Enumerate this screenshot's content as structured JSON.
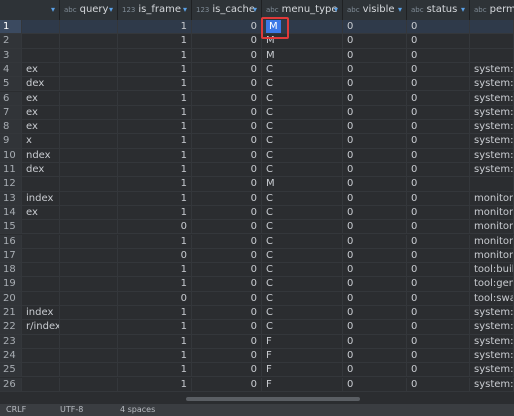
{
  "columns": [
    {
      "label": "",
      "type": ""
    },
    {
      "label": "query",
      "type": "abc"
    },
    {
      "label": "is_frame",
      "type": "123"
    },
    {
      "label": "is_cache",
      "type": "123"
    },
    {
      "label": "menu_type",
      "type": "abc"
    },
    {
      "label": "visible",
      "type": "abc"
    },
    {
      "label": "status",
      "type": "abc"
    },
    {
      "label": "perms",
      "type": "abc"
    }
  ],
  "rows": [
    {
      "num": "1",
      "path": "",
      "query": "",
      "is_frame": "1",
      "is_cache": "0",
      "menu_type": "M",
      "visible": "0",
      "status": "0",
      "perms": ""
    },
    {
      "num": "2",
      "path": "",
      "query": "",
      "is_frame": "1",
      "is_cache": "0",
      "menu_type": "M",
      "visible": "0",
      "status": "0",
      "perms": ""
    },
    {
      "num": "3",
      "path": "",
      "query": "",
      "is_frame": "1",
      "is_cache": "0",
      "menu_type": "M",
      "visible": "0",
      "status": "0",
      "perms": ""
    },
    {
      "num": "4",
      "path": "ex",
      "query": "",
      "is_frame": "1",
      "is_cache": "0",
      "menu_type": "C",
      "visible": "0",
      "status": "0",
      "perms": "system:us"
    },
    {
      "num": "5",
      "path": "dex",
      "query": "",
      "is_frame": "1",
      "is_cache": "0",
      "menu_type": "C",
      "visible": "0",
      "status": "0",
      "perms": "system:m"
    },
    {
      "num": "6",
      "path": "ex",
      "query": "",
      "is_frame": "1",
      "is_cache": "0",
      "menu_type": "C",
      "visible": "0",
      "status": "0",
      "perms": "system:ro"
    },
    {
      "num": "7",
      "path": "ex",
      "query": "",
      "is_frame": "1",
      "is_cache": "0",
      "menu_type": "C",
      "visible": "0",
      "status": "0",
      "perms": "system:po"
    },
    {
      "num": "8",
      "path": "ex",
      "query": "",
      "is_frame": "1",
      "is_cache": "0",
      "menu_type": "C",
      "visible": "0",
      "status": "0",
      "perms": "system:de"
    },
    {
      "num": "9",
      "path": "x",
      "query": "",
      "is_frame": "1",
      "is_cache": "0",
      "menu_type": "C",
      "visible": "0",
      "status": "0",
      "perms": "system:di"
    },
    {
      "num": "10",
      "path": "ndex",
      "query": "",
      "is_frame": "1",
      "is_cache": "0",
      "menu_type": "C",
      "visible": "0",
      "status": "0",
      "perms": "system:co"
    },
    {
      "num": "11",
      "path": "dex",
      "query": "",
      "is_frame": "1",
      "is_cache": "0",
      "menu_type": "C",
      "visible": "0",
      "status": "0",
      "perms": "system:no"
    },
    {
      "num": "12",
      "path": "",
      "query": "",
      "is_frame": "1",
      "is_cache": "0",
      "menu_type": "M",
      "visible": "0",
      "status": "0",
      "perms": ""
    },
    {
      "num": "13",
      "path": "index",
      "query": "",
      "is_frame": "1",
      "is_cache": "0",
      "menu_type": "C",
      "visible": "0",
      "status": "0",
      "perms": "monitor:o"
    },
    {
      "num": "14",
      "path": "ex",
      "query": "",
      "is_frame": "1",
      "is_cache": "0",
      "menu_type": "C",
      "visible": "0",
      "status": "0",
      "perms": "monitor:jo"
    },
    {
      "num": "15",
      "path": "",
      "query": "",
      "is_frame": "0",
      "is_cache": "0",
      "menu_type": "C",
      "visible": "0",
      "status": "0",
      "perms": "monitor:d"
    },
    {
      "num": "16",
      "path": "",
      "query": "",
      "is_frame": "1",
      "is_cache": "0",
      "menu_type": "C",
      "visible": "0",
      "status": "0",
      "perms": "monitor:s"
    },
    {
      "num": "17",
      "path": "",
      "query": "",
      "is_frame": "0",
      "is_cache": "0",
      "menu_type": "C",
      "visible": "0",
      "status": "0",
      "perms": "monitor:c"
    },
    {
      "num": "18",
      "path": "",
      "query": "",
      "is_frame": "1",
      "is_cache": "0",
      "menu_type": "C",
      "visible": "0",
      "status": "0",
      "perms": "tool:build"
    },
    {
      "num": "19",
      "path": "",
      "query": "",
      "is_frame": "1",
      "is_cache": "0",
      "menu_type": "C",
      "visible": "0",
      "status": "0",
      "perms": "tool:gen"
    },
    {
      "num": "20",
      "path": "",
      "query": "",
      "is_frame": "0",
      "is_cache": "0",
      "menu_type": "C",
      "visible": "0",
      "status": "0",
      "perms": "tool:swag"
    },
    {
      "num": "21",
      "path": "index",
      "query": "",
      "is_frame": "1",
      "is_cache": "0",
      "menu_type": "C",
      "visible": "0",
      "status": "0",
      "perms": "system:op"
    },
    {
      "num": "22",
      "path": "r/index",
      "query": "",
      "is_frame": "1",
      "is_cache": "0",
      "menu_type": "C",
      "visible": "0",
      "status": "0",
      "perms": "system:lo"
    },
    {
      "num": "23",
      "path": "",
      "query": "",
      "is_frame": "1",
      "is_cache": "0",
      "menu_type": "F",
      "visible": "0",
      "status": "0",
      "perms": "system:us"
    },
    {
      "num": "24",
      "path": "",
      "query": "",
      "is_frame": "1",
      "is_cache": "0",
      "menu_type": "F",
      "visible": "0",
      "status": "0",
      "perms": "system:us"
    },
    {
      "num": "25",
      "path": "",
      "query": "",
      "is_frame": "1",
      "is_cache": "0",
      "menu_type": "F",
      "visible": "0",
      "status": "0",
      "perms": "system:us"
    },
    {
      "num": "26",
      "path": "",
      "query": "",
      "is_frame": "1",
      "is_cache": "0",
      "menu_type": "F",
      "visible": "0",
      "status": "0",
      "perms": "system:us"
    }
  ],
  "selected_row": 0,
  "statusbar": {
    "items": [
      "CRLF",
      "UTF-8",
      "4 spaces"
    ]
  },
  "colors": {
    "background": "#2b2d30",
    "header": "#2e3337",
    "accent": "#3b78e7",
    "focus_box": "#e03a3a"
  }
}
